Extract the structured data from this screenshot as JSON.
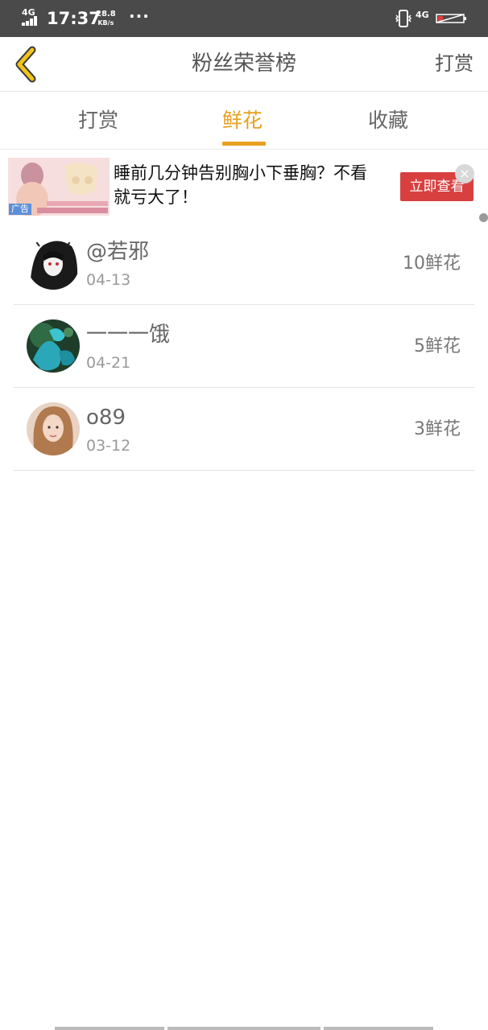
{
  "status_bar": {
    "network": "4G",
    "time": "17:37",
    "speed_value": "28.8",
    "speed_unit": "KB/s",
    "overflow": "···",
    "network_right": "4G"
  },
  "header": {
    "title": "粉丝荣誉榜",
    "right_action": "打赏"
  },
  "tabs": [
    {
      "label": "打赏",
      "active": false
    },
    {
      "label": "鲜花",
      "active": true
    },
    {
      "label": "收藏",
      "active": false
    }
  ],
  "ad": {
    "text": "睡前几分钟告别胸小下垂胸？不看就亏大了！",
    "button": "立即查看",
    "tag": "广告",
    "close": "×"
  },
  "fans": [
    {
      "name": "@若邪",
      "date": "04-13",
      "count": "10鲜花"
    },
    {
      "name": "一一一饿",
      "date": "04-21",
      "count": "5鲜花"
    },
    {
      "name": "o89",
      "date": "03-12",
      "count": "3鲜花"
    }
  ],
  "colors": {
    "accent": "#e8a020",
    "status_bar_bg": "#4a4a4a",
    "ad_button_bg": "#d84040"
  }
}
